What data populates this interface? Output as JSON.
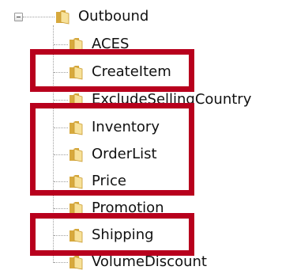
{
  "tree": {
    "root": {
      "label": "Outbound",
      "icon": "folder-icon",
      "expanded": true
    },
    "children": [
      {
        "label": "ACES",
        "icon": "folder-icon"
      },
      {
        "label": "CreateItem",
        "icon": "folder-icon"
      },
      {
        "label": "ExcludeSellingCountry",
        "icon": "folder-icon"
      },
      {
        "label": "Inventory",
        "icon": "folder-icon"
      },
      {
        "label": "OrderList",
        "icon": "folder-icon"
      },
      {
        "label": "Price",
        "icon": "folder-icon"
      },
      {
        "label": "Promotion",
        "icon": "folder-icon"
      },
      {
        "label": "Shipping",
        "icon": "folder-icon"
      },
      {
        "label": "VolumeDiscount",
        "icon": "folder-icon"
      }
    ]
  },
  "colors": {
    "highlight_border": "#b8001d",
    "folder_light": "#f7e199",
    "folder_dark": "#d7a93d",
    "tree_line": "#a0a0a0"
  }
}
